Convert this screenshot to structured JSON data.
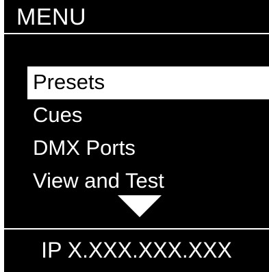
{
  "header": {
    "title": "MENU"
  },
  "menu": {
    "items": [
      {
        "label": "Presets",
        "selected": true
      },
      {
        "label": "Cues",
        "selected": false
      },
      {
        "label": "DMX Ports",
        "selected": false
      },
      {
        "label": "View and Test",
        "selected": false
      }
    ],
    "more_indicator_icon": "triangle-down-icon"
  },
  "footer": {
    "ip_text": "IP X.XXX.XXX.XXX"
  },
  "colors": {
    "background": "#000000",
    "foreground": "#ffffff",
    "selected_background": "#ffffff",
    "selected_text": "#000000"
  }
}
